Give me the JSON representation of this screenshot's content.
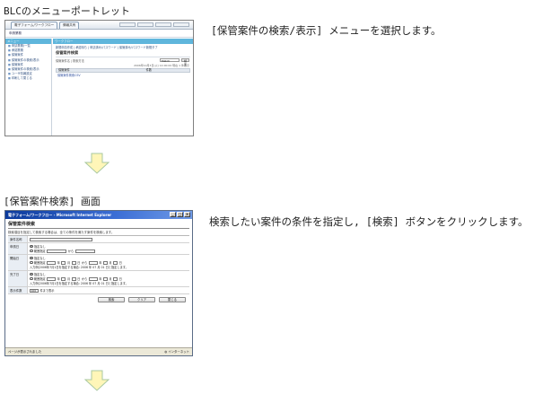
{
  "step1": {
    "caption": "BLCのメニューポートレット",
    "description": "[保管案件の検索/表示] メニューを選択します。",
    "screenshot": {
      "tabs": [
        "電子フォーム/ワークフロー",
        "情報共有"
      ],
      "crumb": "申請業務",
      "left_header": "メニュー",
      "left_items": [
        "申請業務/一覧",
        "承認業務",
        "保管案件",
        "保管案件の検索/表示",
        "保管案件",
        "保管案件の検索/表示",
        "ユーザ情報設定",
        "印刷して閉じる"
      ],
      "main_header": "ワークフロー",
      "main_tabs": "新規申請作成 | 承認待ち | 申請済み/パスワード | 保管済み/パスワード新規タブ",
      "main_title": "保管案件検索",
      "search_label": "保管案件名 | 検索方法",
      "search_select": "Match",
      "search_button": "検索",
      "meta": "2006年10月3日(火) 14:00:00 現在 1 件表示",
      "table_headers": [
        "保管案件",
        "件数"
      ],
      "table_row": "保管案件検索CSV"
    }
  },
  "step2": {
    "caption": "[保管案件検索] 画面",
    "description": "検索したい案件の条件を指定し, [検索] ボタンをクリックします。",
    "screenshot": {
      "window_title": "電子フォーム/ワークフロー - Microsoft Internet Explorer",
      "page_title": "保管案件検索",
      "note": "検索項目を指定して検索する場合は、全ての条件を満たす案件を検索します。",
      "rows": {
        "name_label": "案件名称",
        "apply_label": "申請日",
        "start_label": "開始日",
        "end_label": "完了日",
        "count_label": "表示件数"
      },
      "opt_none": "指定なし",
      "opt_range": "範囲指定",
      "from": "から",
      "year": "年",
      "month": "月",
      "day": "日",
      "period_note": "入力例(2006年7月1日を指定する場合: 2006 年 07 月 01 日と指定します。",
      "count_value": "100",
      "count_suffix": "件まで表示",
      "buttons": [
        "検索",
        "クリア",
        "閉じる"
      ],
      "status": "ページが表示されました",
      "zone": "インターネット"
    }
  },
  "colors": {
    "portlet_header": "#5fb6dc",
    "ie_title_start": "#0b3a9c",
    "arrow_fill": "#fff6b8",
    "arrow_stroke": "#a8c8a0"
  }
}
